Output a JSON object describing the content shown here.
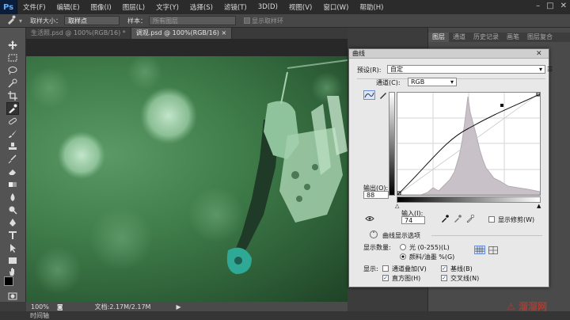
{
  "app": {
    "logo": "Ps"
  },
  "menu": [
    "文件(F)",
    "编辑(E)",
    "图像(I)",
    "图层(L)",
    "文字(Y)",
    "选择(S)",
    "滤镜(T)",
    "3D(D)",
    "视图(V)",
    "窗口(W)",
    "帮助(H)"
  ],
  "options_bar": {
    "sample_size_label": "取样大小：",
    "sample_size_value": "取样点",
    "sample_label": "样本：",
    "sample_value": "所有图层",
    "show_ring_label": "显示取样环"
  },
  "doc_tabs": [
    {
      "label": "生活照.psd @ 100%(RGB/16) *"
    },
    {
      "label": "调观.psd @ 100%(RGB/16) ×"
    }
  ],
  "status": {
    "zoom": "100%",
    "doc_info": "文档:2.17M/2.17M"
  },
  "timeline_label": "时间轴",
  "panel_tabs": [
    "图层",
    "通道",
    "历史记录",
    "画笔",
    "图层复合"
  ],
  "curves": {
    "title": "曲线",
    "preset_label": "预设(R):",
    "preset_value": "自定",
    "channel_label": "通道(C):",
    "channel_value": "RGB",
    "output_label": "输出(O):",
    "output_value": "88",
    "input_label": "输入(I):",
    "input_value": "74",
    "show_clipping_label": "显示修剪(W)",
    "display_options_label": "曲线显示选项",
    "show_amount_label": "显示数量:",
    "light_label": "光 (0-255)(L)",
    "pigment_label": "颜料/油墨 %(G)",
    "show_label": "显示:",
    "channel_overlay_label": "通道叠加(V)",
    "baseline_label": "基线(B)",
    "histogram_label": "直方图(H)",
    "intersection_label": "交叉线(N)",
    "channel_overlay_checked": false,
    "baseline_checked": true,
    "histogram_checked": true,
    "intersection_checked": true,
    "pigment_selected": true,
    "show_clipping_checked": false
  },
  "watermark": "溜溜网"
}
